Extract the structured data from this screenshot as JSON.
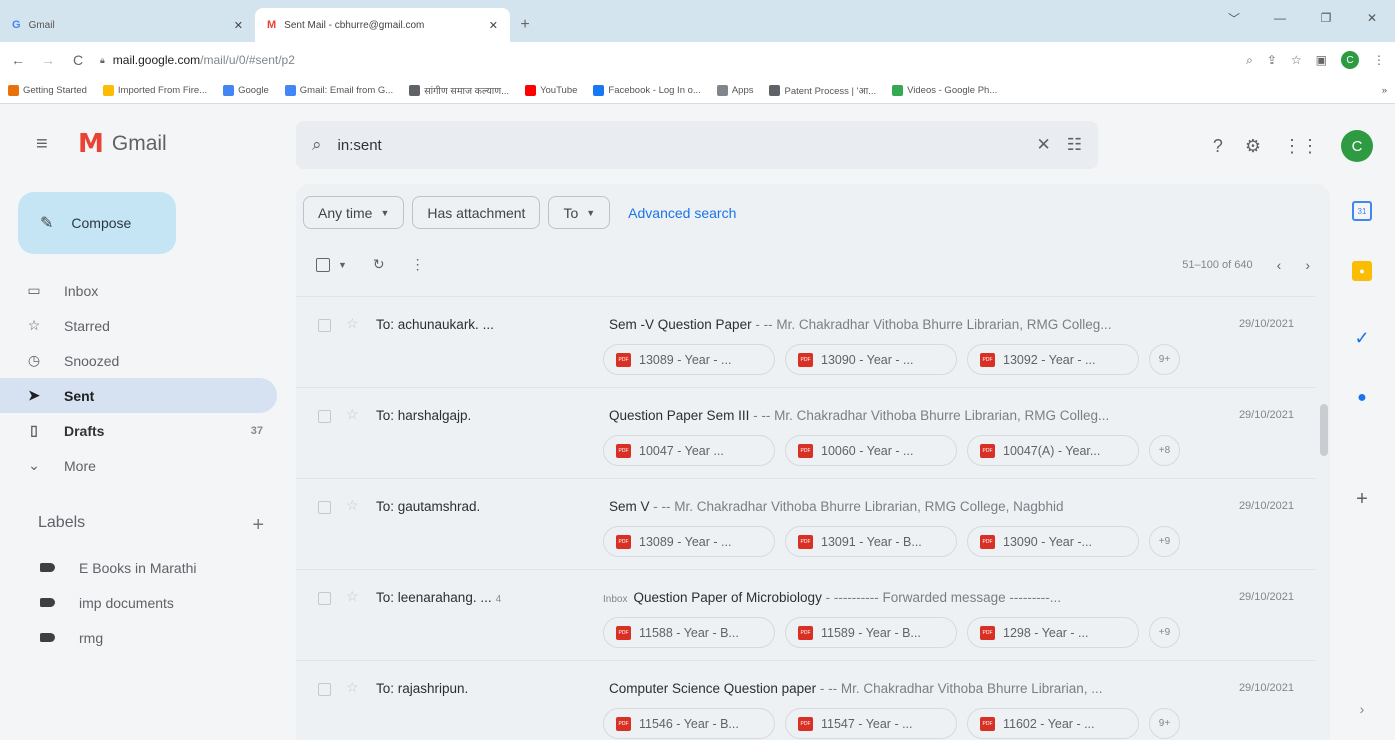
{
  "browser": {
    "tabs": [
      {
        "favicon": "G",
        "title": "Gmail",
        "close": "✕"
      },
      {
        "favicon": "M",
        "title": "Sent Mail - cbhurre@gmail.com",
        "close": "✕"
      }
    ],
    "new_tab": "+",
    "window_controls": [
      "﹀",
      "—",
      "❐",
      "✕"
    ],
    "url_domain": "mail.google.com",
    "url_path": "/mail/u/0/#sent/p2",
    "profile_initial": "C",
    "bookmarks": [
      {
        "label": "Getting Started",
        "color": "#e8710a"
      },
      {
        "label": "Imported From Fire...",
        "color": "#fbbc04"
      },
      {
        "label": "Google",
        "color": "#4285f4"
      },
      {
        "label": "Gmail: Email from G...",
        "color": "#4285f4"
      },
      {
        "label": "सांगीण समाज कल्याण...",
        "color": "#5f6368"
      },
      {
        "label": "YouTube",
        "color": "#ff0000"
      },
      {
        "label": "Facebook - Log In o...",
        "color": "#1877f2"
      },
      {
        "label": "Apps",
        "color": "#80868b"
      },
      {
        "label": "Patent Process | 'आ...",
        "color": "#5f6368"
      },
      {
        "label": "Videos - Google Ph...",
        "color": "#34a853"
      }
    ],
    "bookmarks_overflow": "»"
  },
  "gmail": {
    "logo_text": "Gmail",
    "search_value": "in:sent",
    "avatar_initial": "C",
    "compose_label": "Compose",
    "nav": [
      {
        "label": "Inbox",
        "count": ""
      },
      {
        "label": "Starred",
        "count": ""
      },
      {
        "label": "Snoozed",
        "count": ""
      },
      {
        "label": "Sent",
        "count": ""
      },
      {
        "label": "Drafts",
        "count": "37"
      },
      {
        "label": "More",
        "count": ""
      }
    ],
    "labels_heading": "Labels",
    "labels": [
      "E Books in Marathi",
      "imp documents",
      "rmg"
    ],
    "filters": {
      "any_time": "Any time",
      "has_attachment": "Has attachment",
      "to": "To",
      "advanced_search": "Advanced search"
    },
    "pagination": "51–100 of 640",
    "emails": [
      {
        "to": "To: achunaukark. ...",
        "count": "",
        "inbox_tag": "",
        "subject": "Sem -V Question Paper",
        "snippet": " - -- Mr. Chakradhar Vithoba Bhurre Librarian, RMG Colleg...",
        "date": "29/10/2021",
        "attachments": [
          "13089 - Year - ...",
          "13090 - Year - ...",
          "13092 - Year - ..."
        ],
        "more": "9+"
      },
      {
        "to": "To: harshalgajp.",
        "count": "",
        "inbox_tag": "",
        "subject": "Question Paper Sem III",
        "snippet": " - -- Mr. Chakradhar Vithoba Bhurre Librarian, RMG Colleg...",
        "date": "29/10/2021",
        "attachments": [
          "10047 - Year ...",
          "10060 - Year - ...",
          "10047(A) - Year..."
        ],
        "more": "+8"
      },
      {
        "to": "To: gautamshrad.",
        "count": "",
        "inbox_tag": "",
        "subject": "Sem V",
        "snippet": " - -- Mr. Chakradhar Vithoba Bhurre Librarian, RMG College, Nagbhid",
        "date": "29/10/2021",
        "attachments": [
          "13089 - Year - ...",
          "13091 - Year - B...",
          "13090 - Year -..."
        ],
        "more": "+9"
      },
      {
        "to": "To: leenarahang. ...",
        "count": "4",
        "inbox_tag": "Inbox",
        "subject": "Question Paper of Microbiology",
        "snippet": " - ---------- Forwarded message ---------...",
        "date": "29/10/2021",
        "attachments": [
          "11588 - Year - B...",
          "11589 - Year - B...",
          "1298 - Year - ..."
        ],
        "more": "+9"
      },
      {
        "to": "To: rajashripun.",
        "count": "",
        "inbox_tag": "",
        "subject": "Computer Science Question paper",
        "snippet": " - -- Mr. Chakradhar Vithoba Bhurre Librarian, ...",
        "date": "29/10/2021",
        "attachments": [
          "11546 - Year - B...",
          "11547 - Year - ...",
          "11602 - Year - ..."
        ],
        "more": "9+"
      }
    ]
  },
  "colors": {
    "accent_blue": "#1a73e8",
    "compose_bg": "#c5e4f4",
    "active_nav_bg": "#d6e2f2",
    "pdf_red": "#d93025",
    "avatar_green": "#2e9b42"
  }
}
